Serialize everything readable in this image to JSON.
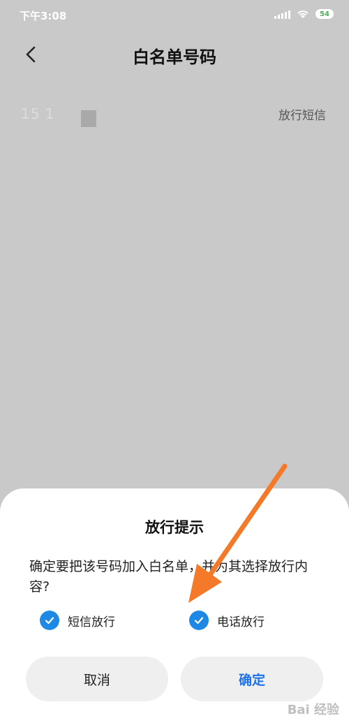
{
  "status_bar": {
    "time": "下午3:08",
    "battery": "54"
  },
  "header": {
    "title": "白名单号码"
  },
  "list": {
    "items": [
      {
        "number": "15 1",
        "status": "放行短信"
      }
    ]
  },
  "dialog": {
    "title": "放行提示",
    "message": "确定要把该号码加入白名单，并为其选择放行内容?",
    "options": [
      {
        "label": "短信放行",
        "checked": true
      },
      {
        "label": "电话放行",
        "checked": true
      }
    ],
    "cancel_label": "取消",
    "confirm_label": "确定"
  },
  "colors": {
    "accent": "#1e88e5",
    "confirm_text": "#1e73e8",
    "annotation_arrow": "#f47a2a"
  },
  "watermark": {
    "text": "Bai 经验"
  }
}
